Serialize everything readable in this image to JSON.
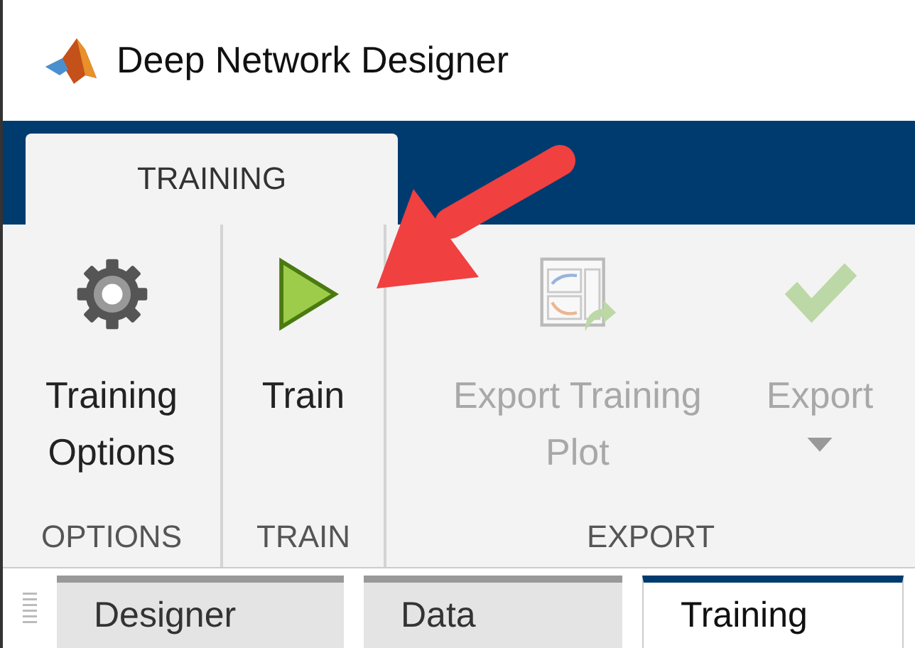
{
  "window": {
    "title": "Deep Network Designer"
  },
  "ribbon_tabs": [
    {
      "label": "TRAINING",
      "selected": true
    }
  ],
  "sections": [
    {
      "label": "OPTIONS",
      "buttons": [
        {
          "label": "Training Options",
          "kind": "gear",
          "disabled": false,
          "dropdown": false
        }
      ]
    },
    {
      "label": "TRAIN",
      "buttons": [
        {
          "label": "Train",
          "kind": "play",
          "disabled": false,
          "dropdown": false
        }
      ]
    },
    {
      "label": "EXPORT",
      "buttons": [
        {
          "label": "Export Training Plot",
          "kind": "plot",
          "disabled": true,
          "dropdown": false
        },
        {
          "label": "Export",
          "kind": "check",
          "disabled": true,
          "dropdown": true
        }
      ]
    }
  ],
  "document_tabs": [
    {
      "label": "Designer",
      "selected": false
    },
    {
      "label": "Data",
      "selected": false
    },
    {
      "label": "Training",
      "selected": true
    }
  ]
}
